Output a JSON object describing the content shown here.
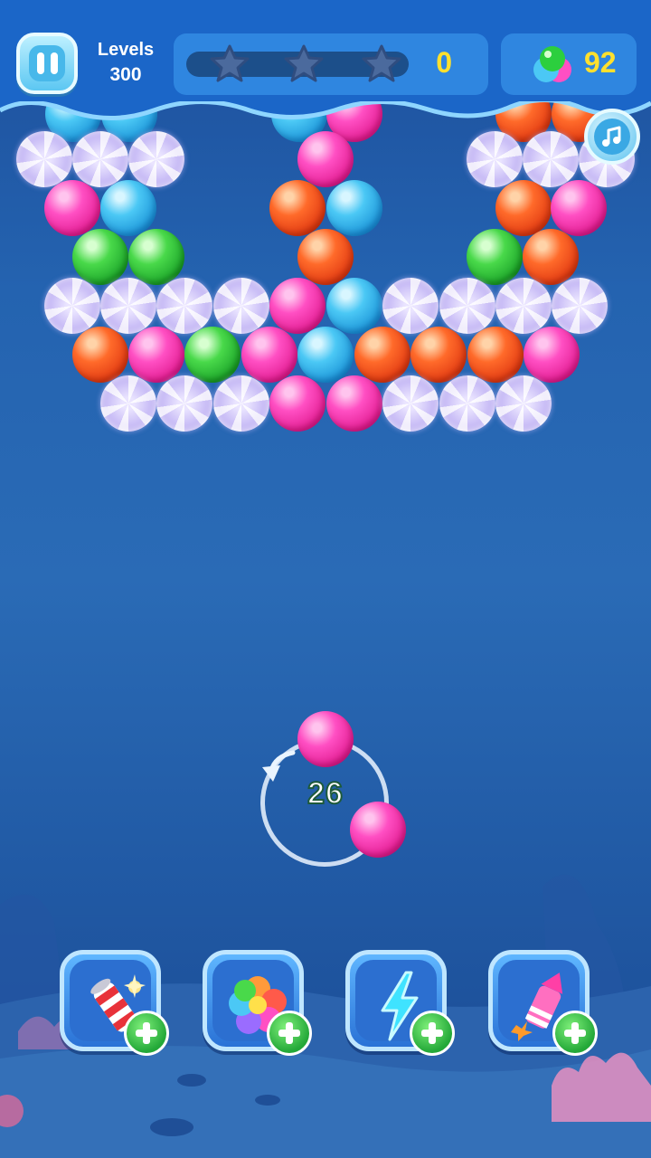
{
  "header": {
    "level_label": "Levels",
    "level_value": "300",
    "score": "0",
    "stars_total": 3,
    "progress_fraction": 0,
    "gem_count": "92"
  },
  "shooter": {
    "moves_left": "26",
    "current_bubble_color": "pink",
    "next_bubble_color": "pink"
  },
  "boosters": [
    {
      "name": "firecracker-booster",
      "icon": "firecracker-icon"
    },
    {
      "name": "color-bubble-booster",
      "icon": "color-balls-icon"
    },
    {
      "name": "lightning-booster",
      "icon": "lightning-icon"
    },
    {
      "name": "rocket-booster",
      "icon": "rocket-icon"
    }
  ],
  "bubble_colors": {
    "pink": "#ff4fc3",
    "red": "#ff6a2a",
    "blue": "#4bc8f5",
    "green": "#49d94a",
    "swirl": "#c9bcf3"
  }
}
